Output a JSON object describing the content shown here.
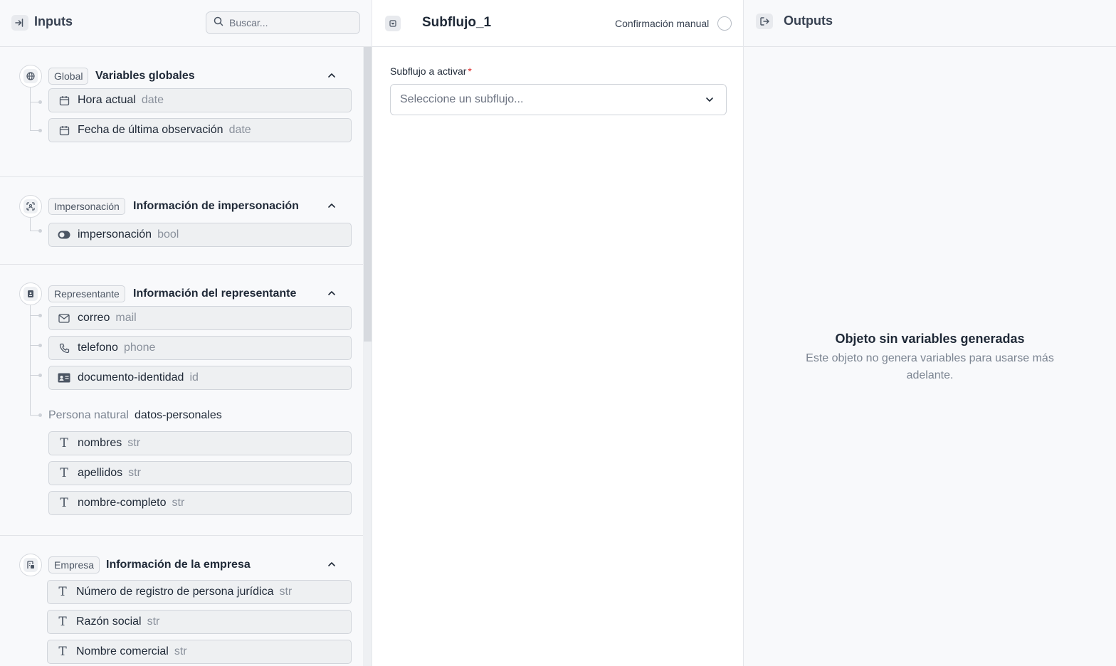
{
  "inputs": {
    "title": "Inputs",
    "search_placeholder": "Buscar...",
    "sections": [
      {
        "badge": "Global",
        "title": "Variables globales",
        "items": [
          {
            "icon": "calendar-icon",
            "name": "Hora actual",
            "type": "date"
          },
          {
            "icon": "calendar-icon",
            "name": "Fecha de última observación",
            "type": "date"
          }
        ]
      },
      {
        "badge": "Impersonación",
        "title": "Información de impersonación",
        "items": [
          {
            "icon": "toggle-icon",
            "name": "impersonación",
            "type": "bool"
          }
        ]
      },
      {
        "badge": "Representante",
        "title": "Información del representante",
        "items": [
          {
            "icon": "mail-icon",
            "name": "correo",
            "type": "mail"
          },
          {
            "icon": "phone-icon",
            "name": "telefono",
            "type": "phone"
          },
          {
            "icon": "id-card-icon",
            "name": "documento-identidad",
            "type": "id"
          }
        ],
        "subgroup": {
          "label": "Persona natural",
          "key": "datos-personales",
          "items": [
            {
              "icon": "text-icon",
              "name": "nombres",
              "type": "str"
            },
            {
              "icon": "text-icon",
              "name": "apellidos",
              "type": "str"
            },
            {
              "icon": "text-icon",
              "name": "nombre-completo",
              "type": "str"
            }
          ]
        }
      },
      {
        "badge": "Empresa",
        "title": "Información de la empresa",
        "items": [
          {
            "icon": "text-icon",
            "name": "Número de registro de persona jurídica",
            "type": "str"
          },
          {
            "icon": "text-icon",
            "name": "Razón social",
            "type": "str"
          },
          {
            "icon": "text-icon",
            "name": "Nombre comercial",
            "type": "str"
          }
        ]
      }
    ]
  },
  "node": {
    "title": "Subflujo_1",
    "manual_confirmation_label": "Confirmación manual",
    "manual_confirmation_on": false,
    "field_label": "Subflujo a activar",
    "required_mark": "*",
    "select_placeholder": "Seleccione un subflujo..."
  },
  "outputs": {
    "title": "Outputs",
    "empty_title": "Objeto sin variables generadas",
    "empty_description": "Este objeto no genera variables para usarse más adelante."
  }
}
